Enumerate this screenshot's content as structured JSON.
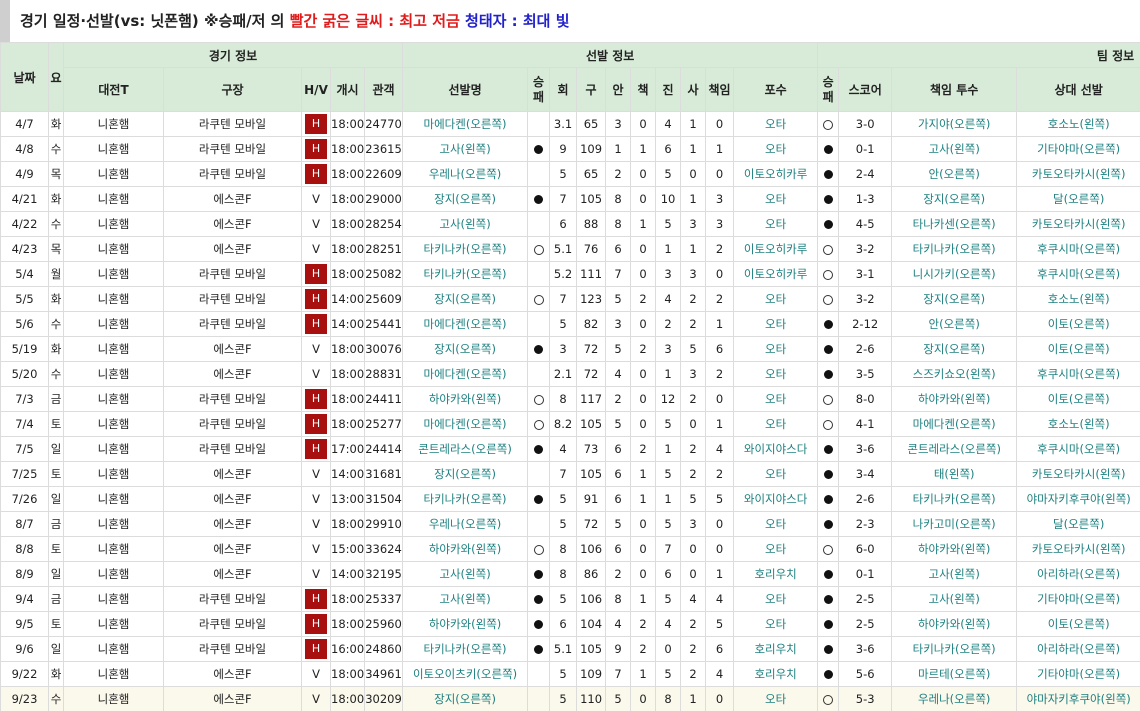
{
  "title": {
    "prefix": "경기 일정·선발(vs: 닛폰햄) ※승패/저 의 ",
    "red_part": "빨간 굵은 글씨 : 최고 저금",
    "blue_part": " 청태자 : 최대 빛"
  },
  "headers": {
    "date": "날짜",
    "day": "요",
    "group_game": "경기 정보",
    "group_starter": "선발 정보",
    "group_team": "팀 정보",
    "opponent": "대전T",
    "stadium": "구장",
    "hv": "H/V",
    "start": "개시",
    "attendance": "관객",
    "starter_name": "선발명",
    "starter_result": "승패",
    "innings": "회",
    "pitches": "구",
    "hits": "안",
    "er": "책",
    "strikeouts": "진",
    "walks": "사",
    "runs": "책임",
    "catcher": "포수",
    "team_result": "승패",
    "score": "스코어",
    "responsible_pitcher": "책임 투수",
    "opp_starter": "상대 선발"
  },
  "rows": [
    {
      "date": "4/7",
      "day": "화",
      "opp": "니혼햄",
      "stadium": "라쿠텐 모바일",
      "hv": "H",
      "time": "18:00",
      "att": "24770",
      "starter": "마에다켄(오른쪽)",
      "sres": "",
      "inn": "3.1",
      "pit": "65",
      "hits": "3",
      "er": "0",
      "so": "4",
      "bb": "1",
      "runs": "0",
      "catcher": "오타",
      "tres": "lose",
      "score": "3-0",
      "resp": "가지야(오른쪽)",
      "opps": "호소노(왼쪽)"
    },
    {
      "date": "4/8",
      "day": "수",
      "opp": "니혼햄",
      "stadium": "라쿠텐 모바일",
      "hv": "H",
      "time": "18:00",
      "att": "23615",
      "starter": "고사(왼쪽)",
      "sres": "win",
      "inn": "9",
      "pit": "109",
      "hits": "1",
      "er": "1",
      "so": "6",
      "bb": "1",
      "runs": "1",
      "catcher": "오타",
      "tres": "win",
      "score": "0-1",
      "resp": "고사(왼쪽)",
      "opps": "기타야마(오른쪽)"
    },
    {
      "date": "4/9",
      "day": "목",
      "opp": "니혼햄",
      "stadium": "라쿠텐 모바일",
      "hv": "H",
      "time": "18:00",
      "att": "22609",
      "starter": "우레나(오른쪽)",
      "sres": "",
      "inn": "5",
      "pit": "65",
      "hits": "2",
      "er": "0",
      "so": "5",
      "bb": "0",
      "runs": "0",
      "catcher": "이토오히카루",
      "tres": "win",
      "score": "2-4",
      "resp": "안(오른쪽)",
      "opps": "카토오타카시(왼쪽)"
    },
    {
      "date": "4/21",
      "day": "화",
      "opp": "니혼햄",
      "stadium": "에스콘F",
      "hv": "V",
      "time": "18:00",
      "att": "29000",
      "starter": "장지(오른쪽)",
      "sres": "win",
      "inn": "7",
      "pit": "105",
      "hits": "8",
      "er": "0",
      "so": "10",
      "bb": "1",
      "runs": "3",
      "catcher": "오타",
      "tres": "win",
      "score": "1-3",
      "resp": "장지(오른쪽)",
      "opps": "달(오른쪽)"
    },
    {
      "date": "4/22",
      "day": "수",
      "opp": "니혼햄",
      "stadium": "에스콘F",
      "hv": "V",
      "time": "18:00",
      "att": "28254",
      "starter": "고사(왼쪽)",
      "sres": "",
      "inn": "6",
      "pit": "88",
      "hits": "8",
      "er": "1",
      "so": "5",
      "bb": "3",
      "runs": "3",
      "catcher": "오타",
      "tres": "win",
      "score": "4-5",
      "resp": "타나카센(오른쪽)",
      "opps": "카토오타카시(왼쪽)"
    },
    {
      "date": "4/23",
      "day": "목",
      "opp": "니혼햄",
      "stadium": "에스콘F",
      "hv": "V",
      "time": "18:00",
      "att": "28251",
      "starter": "타키나카(오른쪽)",
      "sres": "lose",
      "inn": "5.1",
      "pit": "76",
      "hits": "6",
      "er": "0",
      "so": "1",
      "bb": "1",
      "runs": "2",
      "catcher": "이토오히카루",
      "tres": "lose",
      "score": "3-2",
      "resp": "타키나카(오른쪽)",
      "opps": "후쿠시마(오른쪽)"
    },
    {
      "date": "5/4",
      "day": "월",
      "opp": "니혼햄",
      "stadium": "라쿠텐 모바일",
      "hv": "H",
      "time": "18:00",
      "att": "25082",
      "starter": "타키나카(오른쪽)",
      "sres": "",
      "inn": "5.2",
      "pit": "111",
      "hits": "7",
      "er": "0",
      "so": "3",
      "bb": "3",
      "runs": "0",
      "catcher": "이토오히카루",
      "tres": "lose",
      "score": "3-1",
      "resp": "니시가키(오른쪽)",
      "opps": "후쿠시마(오른쪽)"
    },
    {
      "date": "5/5",
      "day": "화",
      "opp": "니혼햄",
      "stadium": "라쿠텐 모바일",
      "hv": "H",
      "time": "14:00",
      "att": "25609",
      "starter": "장지(오른쪽)",
      "sres": "lose",
      "inn": "7",
      "pit": "123",
      "hits": "5",
      "er": "2",
      "so": "4",
      "bb": "2",
      "runs": "2",
      "catcher": "오타",
      "tres": "lose",
      "score": "3-2",
      "resp": "장지(오른쪽)",
      "opps": "호소노(왼쪽)"
    },
    {
      "date": "5/6",
      "day": "수",
      "opp": "니혼햄",
      "stadium": "라쿠텐 모바일",
      "hv": "H",
      "time": "14:00",
      "att": "25441",
      "starter": "마에다켄(오른쪽)",
      "sres": "",
      "inn": "5",
      "pit": "82",
      "hits": "3",
      "er": "0",
      "so": "2",
      "bb": "2",
      "runs": "1",
      "catcher": "오타",
      "tres": "win",
      "score": "2-12",
      "resp": "안(오른쪽)",
      "opps": "이토(오른쪽)"
    },
    {
      "date": "5/19",
      "day": "화",
      "opp": "니혼햄",
      "stadium": "에스콘F",
      "hv": "V",
      "time": "18:00",
      "att": "30076",
      "starter": "장지(오른쪽)",
      "sres": "win",
      "inn": "3",
      "pit": "72",
      "hits": "5",
      "er": "2",
      "so": "3",
      "bb": "5",
      "runs": "6",
      "catcher": "오타",
      "tres": "win",
      "score": "2-6",
      "resp": "장지(오른쪽)",
      "opps": "이토(오른쪽)"
    },
    {
      "date": "5/20",
      "day": "수",
      "opp": "니혼햄",
      "stadium": "에스콘F",
      "hv": "V",
      "time": "18:00",
      "att": "28831",
      "starter": "마에다켄(오른쪽)",
      "sres": "",
      "inn": "2.1",
      "pit": "72",
      "hits": "4",
      "er": "0",
      "so": "1",
      "bb": "3",
      "runs": "2",
      "catcher": "오타",
      "tres": "win",
      "score": "3-5",
      "resp": "스즈키쇼오(왼쪽)",
      "opps": "후쿠시마(오른쪽)"
    },
    {
      "date": "7/3",
      "day": "금",
      "opp": "니혼햄",
      "stadium": "라쿠텐 모바일",
      "hv": "H",
      "time": "18:00",
      "att": "24411",
      "starter": "하야카와(왼쪽)",
      "sres": "lose",
      "inn": "8",
      "pit": "117",
      "hits": "2",
      "er": "0",
      "so": "12",
      "bb": "2",
      "runs": "0",
      "catcher": "오타",
      "tres": "lose",
      "score": "8-0",
      "resp": "하야카와(왼쪽)",
      "opps": "이토(오른쪽)"
    },
    {
      "date": "7/4",
      "day": "토",
      "opp": "니혼햄",
      "stadium": "라쿠텐 모바일",
      "hv": "H",
      "time": "18:00",
      "att": "25277",
      "starter": "마에다켄(오른쪽)",
      "sres": "lose",
      "inn": "8.2",
      "pit": "105",
      "hits": "5",
      "er": "0",
      "so": "5",
      "bb": "0",
      "runs": "1",
      "catcher": "오타",
      "tres": "lose",
      "score": "4-1",
      "resp": "마에다켄(오른쪽)",
      "opps": "호소노(왼쪽)"
    },
    {
      "date": "7/5",
      "day": "일",
      "opp": "니혼햄",
      "stadium": "라쿠텐 모바일",
      "hv": "H",
      "time": "17:00",
      "att": "24414",
      "starter": "콘트레라스(오른쪽)",
      "sres": "win",
      "inn": "4",
      "pit": "73",
      "hits": "6",
      "er": "2",
      "so": "1",
      "bb": "2",
      "runs": "4",
      "catcher": "와이지야스다",
      "tres": "win",
      "score": "3-6",
      "resp": "콘트레라스(오른쪽)",
      "opps": "후쿠시마(오른쪽)"
    },
    {
      "date": "7/25",
      "day": "토",
      "opp": "니혼햄",
      "stadium": "에스콘F",
      "hv": "V",
      "time": "14:00",
      "att": "31681",
      "starter": "장지(오른쪽)",
      "sres": "",
      "inn": "7",
      "pit": "105",
      "hits": "6",
      "er": "1",
      "so": "5",
      "bb": "2",
      "runs": "2",
      "catcher": "오타",
      "tres": "win",
      "score": "3-4",
      "resp": "태(왼쪽)",
      "opps": "카토오타카시(왼쪽)"
    },
    {
      "date": "7/26",
      "day": "일",
      "opp": "니혼햄",
      "stadium": "에스콘F",
      "hv": "V",
      "time": "13:00",
      "att": "31504",
      "starter": "타키나카(오른쪽)",
      "sres": "win",
      "inn": "5",
      "pit": "91",
      "hits": "6",
      "er": "1",
      "so": "1",
      "bb": "5",
      "runs": "5",
      "catcher": "와이지야스다",
      "tres": "win",
      "score": "2-6",
      "resp": "타키나카(오른쪽)",
      "opps": "야마자키후쿠야(왼쪽)"
    },
    {
      "date": "8/7",
      "day": "금",
      "opp": "니혼햄",
      "stadium": "에스콘F",
      "hv": "V",
      "time": "18:00",
      "att": "29910",
      "starter": "우레나(오른쪽)",
      "sres": "",
      "inn": "5",
      "pit": "72",
      "hits": "5",
      "er": "0",
      "so": "5",
      "bb": "3",
      "runs": "0",
      "catcher": "오타",
      "tres": "win",
      "score": "2-3",
      "resp": "나카고미(오른쪽)",
      "opps": "달(오른쪽)"
    },
    {
      "date": "8/8",
      "day": "토",
      "opp": "니혼햄",
      "stadium": "에스콘F",
      "hv": "V",
      "time": "15:00",
      "att": "33624",
      "starter": "하야카와(왼쪽)",
      "sres": "lose",
      "inn": "8",
      "pit": "106",
      "hits": "6",
      "er": "0",
      "so": "7",
      "bb": "0",
      "runs": "0",
      "catcher": "오타",
      "tres": "lose",
      "score": "6-0",
      "resp": "하야카와(왼쪽)",
      "opps": "카토오타카시(왼쪽)"
    },
    {
      "date": "8/9",
      "day": "일",
      "opp": "니혼햄",
      "stadium": "에스콘F",
      "hv": "V",
      "time": "14:00",
      "att": "32195",
      "starter": "고사(왼쪽)",
      "sres": "win",
      "inn": "8",
      "pit": "86",
      "hits": "2",
      "er": "0",
      "so": "6",
      "bb": "0",
      "runs": "1",
      "catcher": "호리우치",
      "tres": "win",
      "score": "0-1",
      "resp": "고사(왼쪽)",
      "opps": "아리하라(오른쪽)"
    },
    {
      "date": "9/4",
      "day": "금",
      "opp": "니혼햄",
      "stadium": "라쿠텐 모바일",
      "hv": "H",
      "time": "18:00",
      "att": "25337",
      "starter": "고사(왼쪽)",
      "sres": "win",
      "inn": "5",
      "pit": "106",
      "hits": "8",
      "er": "1",
      "so": "5",
      "bb": "4",
      "runs": "4",
      "catcher": "오타",
      "tres": "win",
      "score": "2-5",
      "resp": "고사(왼쪽)",
      "opps": "기타야마(오른쪽)"
    },
    {
      "date": "9/5",
      "day": "토",
      "opp": "니혼햄",
      "stadium": "라쿠텐 모바일",
      "hv": "H",
      "time": "18:00",
      "att": "25960",
      "starter": "하야카와(왼쪽)",
      "sres": "win",
      "inn": "6",
      "pit": "104",
      "hits": "4",
      "er": "2",
      "so": "4",
      "bb": "2",
      "runs": "5",
      "catcher": "오타",
      "tres": "win",
      "score": "2-5",
      "resp": "하야카와(왼쪽)",
      "opps": "이토(오른쪽)"
    },
    {
      "date": "9/6",
      "day": "일",
      "opp": "니혼햄",
      "stadium": "라쿠텐 모바일",
      "hv": "H",
      "time": "16:00",
      "att": "24860",
      "starter": "타키나카(오른쪽)",
      "sres": "win",
      "inn": "5.1",
      "pit": "105",
      "hits": "9",
      "er": "2",
      "so": "0",
      "bb": "2",
      "runs": "6",
      "catcher": "호리우치",
      "tres": "win",
      "score": "3-6",
      "resp": "타키나카(오른쪽)",
      "opps": "아리하라(오른쪽)"
    },
    {
      "date": "9/22",
      "day": "화",
      "opp": "니혼햄",
      "stadium": "에스콘F",
      "hv": "V",
      "time": "18:00",
      "att": "34961",
      "starter": "이토오이츠키(오른쪽)",
      "sres": "",
      "inn": "5",
      "pit": "109",
      "hits": "7",
      "er": "1",
      "so": "5",
      "bb": "2",
      "runs": "4",
      "catcher": "호리우치",
      "tres": "win",
      "score": "5-6",
      "resp": "마르테(오른쪽)",
      "opps": "기타야마(오른쪽)"
    },
    {
      "date": "9/23",
      "day": "수",
      "opp": "니혼햄",
      "stadium": "에스콘F",
      "hv": "V",
      "time": "18:00",
      "att": "30209",
      "starter": "장지(오른쪽)",
      "sres": "",
      "inn": "5",
      "pit": "110",
      "hits": "5",
      "er": "0",
      "so": "8",
      "bb": "1",
      "runs": "0",
      "catcher": "오타",
      "tres": "lose",
      "score": "5-3",
      "resp": "우레나(오른쪽)",
      "opps": "야마자키후쿠야(왼쪽)"
    }
  ],
  "colors": {
    "header_bg": "#d8ebd8",
    "home_badge": "#a81010",
    "link": "#1e8080",
    "red": "#e01b1b",
    "blue": "#2222cc"
  }
}
